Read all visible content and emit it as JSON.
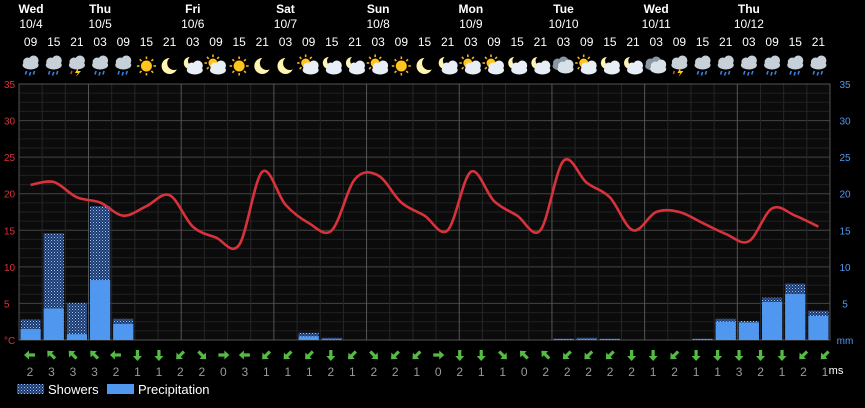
{
  "days": [
    {
      "name": "Wed",
      "date": "10/4"
    },
    {
      "name": "Thu",
      "date": "10/5"
    },
    {
      "name": "Fri",
      "date": "10/6"
    },
    {
      "name": "Sat",
      "date": "10/7"
    },
    {
      "name": "Sun",
      "date": "10/8"
    },
    {
      "name": "Mon",
      "date": "10/9"
    },
    {
      "name": "Tue",
      "date": "10/10"
    },
    {
      "name": "Wed",
      "date": "10/11"
    },
    {
      "name": "Thu",
      "date": "10/12"
    }
  ],
  "colors": {
    "temperature": "#d8323c",
    "precipitation": "#4f97ef",
    "axis_left": "#d8323c",
    "axis_right": "#4f97ef",
    "grid": "#3a3a3a",
    "arrow": "#55bb44"
  },
  "legend": {
    "showers": "Showers",
    "precipitation": "Precipitation"
  },
  "wind_unit": "ms",
  "chart_data": {
    "type": "line+bar",
    "hours": [
      "09",
      "15",
      "21",
      "03",
      "09",
      "15",
      "21",
      "03",
      "09",
      "15",
      "21",
      "03",
      "09",
      "15",
      "21",
      "03",
      "09",
      "15",
      "21",
      "03",
      "09",
      "15",
      "21",
      "03",
      "09",
      "15",
      "21",
      "03",
      "09",
      "15",
      "21",
      "03",
      "09",
      "15",
      "21"
    ],
    "weather_icons": [
      "cloudy-rain",
      "cloudy-rain",
      "thunderstorm",
      "cloudy-rain",
      "cloudy-rain",
      "sun",
      "moon",
      "moon-cloud",
      "sun-cloud",
      "sun",
      "moon",
      "moon",
      "sun-cloud",
      "moon-cloud",
      "moon-cloud",
      "sun-cloud",
      "sun",
      "moon",
      "moon-cloud",
      "sun-cloud",
      "sun-cloud",
      "moon-cloud",
      "moon-cloud",
      "cloudy",
      "sun-cloud",
      "moon-cloud",
      "moon-cloud",
      "cloudy",
      "thunderstorm",
      "cloudy-rain",
      "cloudy-rain",
      "cloudy-rain",
      "cloudy-rain",
      "cloudy-rain",
      "cloudy-rain"
    ],
    "temperature": {
      "unit": "°C",
      "ylim": [
        0,
        35
      ],
      "ticks": [
        5,
        10,
        15,
        20,
        25,
        30,
        35
      ],
      "values": [
        21.2,
        21.6,
        19.5,
        18.8,
        17.0,
        18.3,
        19.8,
        15.5,
        14.0,
        13.0,
        23.0,
        18.5,
        16.0,
        15.0,
        22.0,
        22.5,
        18.8,
        17.0,
        15.0,
        23.0,
        19.0,
        17.0,
        15.0,
        24.5,
        21.5,
        19.5,
        15.0,
        17.5,
        17.5,
        16.0,
        14.5,
        13.5,
        18.0,
        17.0,
        15.5
      ]
    },
    "precipitation": {
      "unit": "mm",
      "ylim": [
        0,
        35
      ],
      "ticks": [
        5,
        10,
        15,
        20,
        25,
        30,
        35
      ],
      "showers": [
        2.8,
        14.6,
        5.1,
        18.3,
        2.9,
        0,
        0,
        0,
        0,
        0,
        0,
        0,
        1.0,
        0.3,
        0,
        0,
        0,
        0,
        0,
        0,
        0,
        0,
        0,
        0.2,
        0.3,
        0.2,
        0,
        0,
        0,
        0.2,
        2.9,
        2.6,
        5.8,
        7.7,
        4.0
      ],
      "values": [
        1.5,
        4.3,
        0.8,
        8.2,
        2.2,
        0,
        0,
        0,
        0,
        0,
        0,
        0,
        0.5,
        0.1,
        0,
        0,
        0,
        0,
        0,
        0,
        0,
        0,
        0,
        0.1,
        0.1,
        0.1,
        0,
        0,
        0,
        0.1,
        2.5,
        2.4,
        5.2,
        6.3,
        3.3
      ]
    },
    "wind": {
      "unit": "ms",
      "speeds": [
        "2",
        "3",
        "3",
        "3",
        "2",
        "1",
        "1",
        "2",
        "2",
        "0",
        "3",
        "1",
        "1",
        "1",
        "2",
        "1",
        "2",
        "2",
        "1",
        "0",
        "2",
        "1",
        "1",
        "0",
        "2",
        "2",
        "2",
        "2",
        "2",
        "1",
        "2",
        "1",
        "1",
        "3",
        "2",
        "1",
        "2",
        "1"
      ],
      "directions_deg": [
        270,
        315,
        315,
        315,
        270,
        180,
        180,
        225,
        135,
        90,
        270,
        225,
        225,
        225,
        180,
        225,
        135,
        225,
        225,
        90,
        180,
        180,
        135,
        315,
        315,
        225,
        225,
        225,
        180,
        180,
        225,
        180,
        180,
        180,
        180,
        180,
        225,
        225
      ]
    }
  }
}
